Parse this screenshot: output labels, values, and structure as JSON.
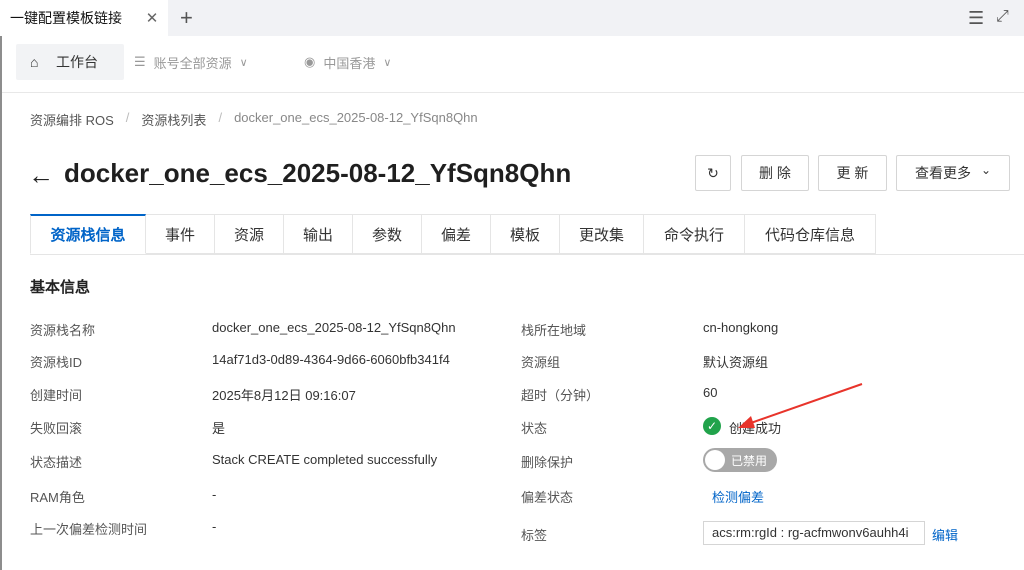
{
  "browser": {
    "tab_title": "一键配置模板链接",
    "close_glyph": "✕",
    "newtab_glyph": "+",
    "menu_glyph": "☰",
    "expand_glyph": "⤢"
  },
  "console": {
    "workbench_label": "工作台",
    "account_scope": "账号全部资源",
    "region": "中国香港"
  },
  "breadcrumb": {
    "items": [
      "资源编排 ROS",
      "资源栈列表",
      "docker_one_ecs_2025-08-12_YfSqn8Qhn"
    ],
    "separator": "/"
  },
  "header": {
    "back_glyph": "←",
    "title": "docker_one_ecs_2025-08-12_YfSqn8Qhn",
    "refresh_glyph": "↻",
    "delete_label": "删 除",
    "update_label": "更 新",
    "more_label": "查看更多",
    "more_chevron": "⌄"
  },
  "tabs": [
    "资源栈信息",
    "事件",
    "资源",
    "输出",
    "参数",
    "偏差",
    "模板",
    "更改集",
    "命令执行",
    "代码仓库信息"
  ],
  "section_title": "基本信息",
  "left_fields": [
    {
      "label": "资源栈名称",
      "value": "docker_one_ecs_2025-08-12_YfSqn8Qhn"
    },
    {
      "label": "资源栈ID",
      "value": "14af71d3-0d89-4364-9d66-6060bfb341f4"
    },
    {
      "label": "创建时间",
      "value": "2025年8月12日 09:16:07"
    },
    {
      "label": "失败回滚",
      "value": "是"
    },
    {
      "label": "状态描述",
      "value": "Stack CREATE completed successfully"
    },
    {
      "label": "RAM角色",
      "value": "-"
    },
    {
      "label": "上一次偏差检测时间",
      "value": "-"
    }
  ],
  "right_fields": {
    "region_label": "栈所在地域",
    "region_value": "cn-hongkong",
    "group_label": "资源组",
    "group_value": "默认资源组",
    "timeout_label": "超时（分钟）",
    "timeout_value": "60",
    "status_label": "状态",
    "status_value": "创建成功",
    "status_glyph": "✓",
    "protect_label": "删除保护",
    "protect_value": "已禁用",
    "drift_label": "偏差状态",
    "drift_link": "检测偏差",
    "tag_label": "标签",
    "tag_value": "acs:rm:rgId : rg-acfmwonv6auhh4i",
    "tag_edit": "编辑"
  },
  "colors": {
    "accent": "#0064c8",
    "success": "#21a34b",
    "annotation_arrow": "#e8342b",
    "toggle_off": "#a8a8a8"
  }
}
